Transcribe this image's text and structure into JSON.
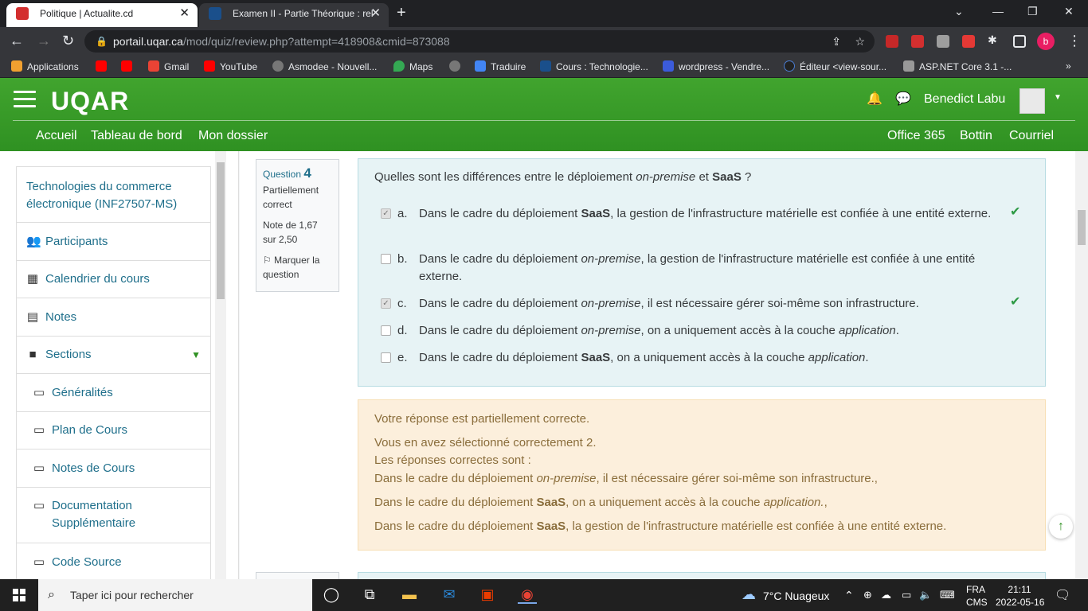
{
  "browser": {
    "tabs": [
      {
        "title": "Politique | Actualite.cd",
        "favicon_color": "#d32f2f"
      },
      {
        "title": "Examen II - Partie Théorique : rel",
        "favicon_color": "#1a4f8b"
      }
    ],
    "url": {
      "host": "portail.uqar.ca",
      "path": "/mod/quiz/review.php?attempt=418908&cmid=873088"
    },
    "profile_initial": "b",
    "bookmarks": [
      {
        "label": "Applications",
        "icon_color": "#f0a030"
      },
      {
        "label": "",
        "icon_color": "#ff0000"
      },
      {
        "label": "",
        "icon_color": "#ff0000"
      },
      {
        "label": "Gmail",
        "icon_color": "#ea4335"
      },
      {
        "label": "YouTube",
        "icon_color": "#ff0000"
      },
      {
        "label": "Asmodee - Nouvell...",
        "icon_color": "#777777"
      },
      {
        "label": "Maps",
        "icon_color": "#34a853"
      },
      {
        "label": "",
        "icon_color": "#777777"
      },
      {
        "label": "Traduire",
        "icon_color": "#4285f4"
      },
      {
        "label": "Cours : Technologie...",
        "icon_color": "#1a4f8b"
      },
      {
        "label": "wordpress - Vendre...",
        "icon_color": "#3b5bdb"
      },
      {
        "label": "Éditeur <view-sour...",
        "icon_color": "#222222"
      },
      {
        "label": "ASP.NET Core 3.1 -...",
        "icon_color": "#999999"
      }
    ],
    "bookmarks_more": "»"
  },
  "site": {
    "logo": "UQAR",
    "user_name": "Benedict Labu",
    "nav_left": [
      "Accueil",
      "Tableau de bord",
      "Mon dossier"
    ],
    "nav_right": [
      "Office 365",
      "Bottin",
      "Courriel"
    ]
  },
  "sidebar": {
    "course_title": "Technologies du commerce électronique (INF27507-MS)",
    "items": [
      {
        "label": "Participants",
        "icon": "users-icon",
        "glyph": "👥"
      },
      {
        "label": "Calendrier du cours",
        "icon": "calendar-icon",
        "glyph": "▦"
      },
      {
        "label": "Notes",
        "icon": "table-icon",
        "glyph": "▤"
      },
      {
        "label": "Sections",
        "icon": "folder-icon",
        "glyph": "■"
      }
    ],
    "sections": [
      {
        "label": "Généralités"
      },
      {
        "label": "Plan de Cours"
      },
      {
        "label": "Notes de Cours"
      },
      {
        "label": "Documentation Supplémentaire"
      },
      {
        "label": "Code Source"
      }
    ]
  },
  "question": {
    "label": "Question",
    "number": "4",
    "state": "Partiellement correct",
    "grade": "Note de 1,67 sur 2,50",
    "flag": "Marquer la question",
    "prompt_before": "Quelles sont les différences entre le déploiement ",
    "prompt_em": "on-premise",
    "prompt_mid": " et ",
    "prompt_bold": "SaaS",
    "prompt_after": " ?",
    "answers": [
      {
        "letter": "a.",
        "checked": true,
        "correct_tick": true,
        "parts": [
          "Dans le cadre du déploiement ",
          "SaaS",
          ", la gestion de l'infrastructure matérielle est confiée à une entité externe."
        ],
        "style": "bold"
      },
      {
        "letter": "b.",
        "checked": false,
        "correct_tick": false,
        "parts": [
          "Dans le cadre du déploiement ",
          "on-premise",
          ", la gestion de l'infrastructure matérielle est confiée à une entité externe."
        ],
        "style": "em"
      },
      {
        "letter": "c.",
        "checked": true,
        "correct_tick": true,
        "parts": [
          "Dans le cadre du déploiement ",
          "on-premise",
          ", il est nécessaire gérer soi-même son infrastructure."
        ],
        "style": "em"
      },
      {
        "letter": "d.",
        "checked": false,
        "correct_tick": false,
        "parts": [
          "Dans le cadre du déploiement ",
          "on-premise",
          ", on a uniquement accès à la couche ",
          "application",
          "."
        ],
        "style": "em2"
      },
      {
        "letter": "e.",
        "checked": false,
        "correct_tick": false,
        "parts": [
          "Dans le cadre du déploiement ",
          "SaaS",
          ", on a uniquement accès à la couche ",
          "application",
          "."
        ],
        "style": "bold-em"
      }
    ]
  },
  "feedback": {
    "summary": "Votre réponse est partiellement correcte.",
    "selected": "Vous en avez sélectionné correctement 2.",
    "correct_header": "Les réponses correctes sont :",
    "r1": [
      "Dans le cadre du déploiement ",
      "on-premise",
      ", il est nécessaire gérer soi-même son infrastructure.,"
    ],
    "r2": [
      "Dans le cadre du déploiement ",
      "SaaS",
      ", on a uniquement accès à la couche ",
      "application.",
      ","
    ],
    "r3": [
      "Dans le cadre du déploiement ",
      "SaaS",
      ", la gestion de l'infrastructure matérielle est confiée à une entité externe."
    ]
  },
  "taskbar": {
    "search_placeholder": "Taper ici pour rechercher",
    "weather": "7°C  Nuageux",
    "lang1": "FRA",
    "lang2": "CMS",
    "time": "21:11",
    "date": "2022-05-16"
  }
}
